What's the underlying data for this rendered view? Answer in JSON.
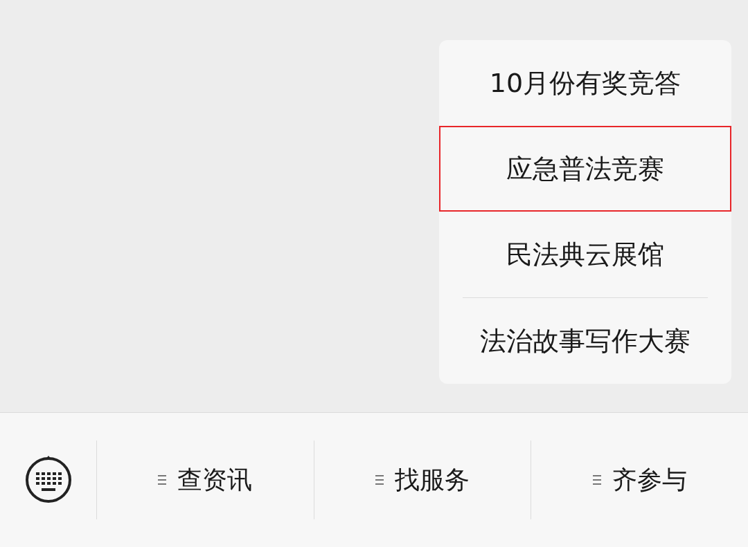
{
  "popup_menu": {
    "items": [
      {
        "label": "10月份有奖竞答",
        "highlighted": false,
        "divider_above": false
      },
      {
        "label": "应急普法竞赛",
        "highlighted": true,
        "divider_above": false
      },
      {
        "label": "民法典云展馆",
        "highlighted": false,
        "divider_above": false
      },
      {
        "label": "法治故事写作大赛",
        "highlighted": false,
        "divider_above": true
      }
    ]
  },
  "bottom_bar": {
    "tabs": [
      {
        "label": "查资讯"
      },
      {
        "label": "找服务"
      },
      {
        "label": "齐参与"
      }
    ]
  }
}
